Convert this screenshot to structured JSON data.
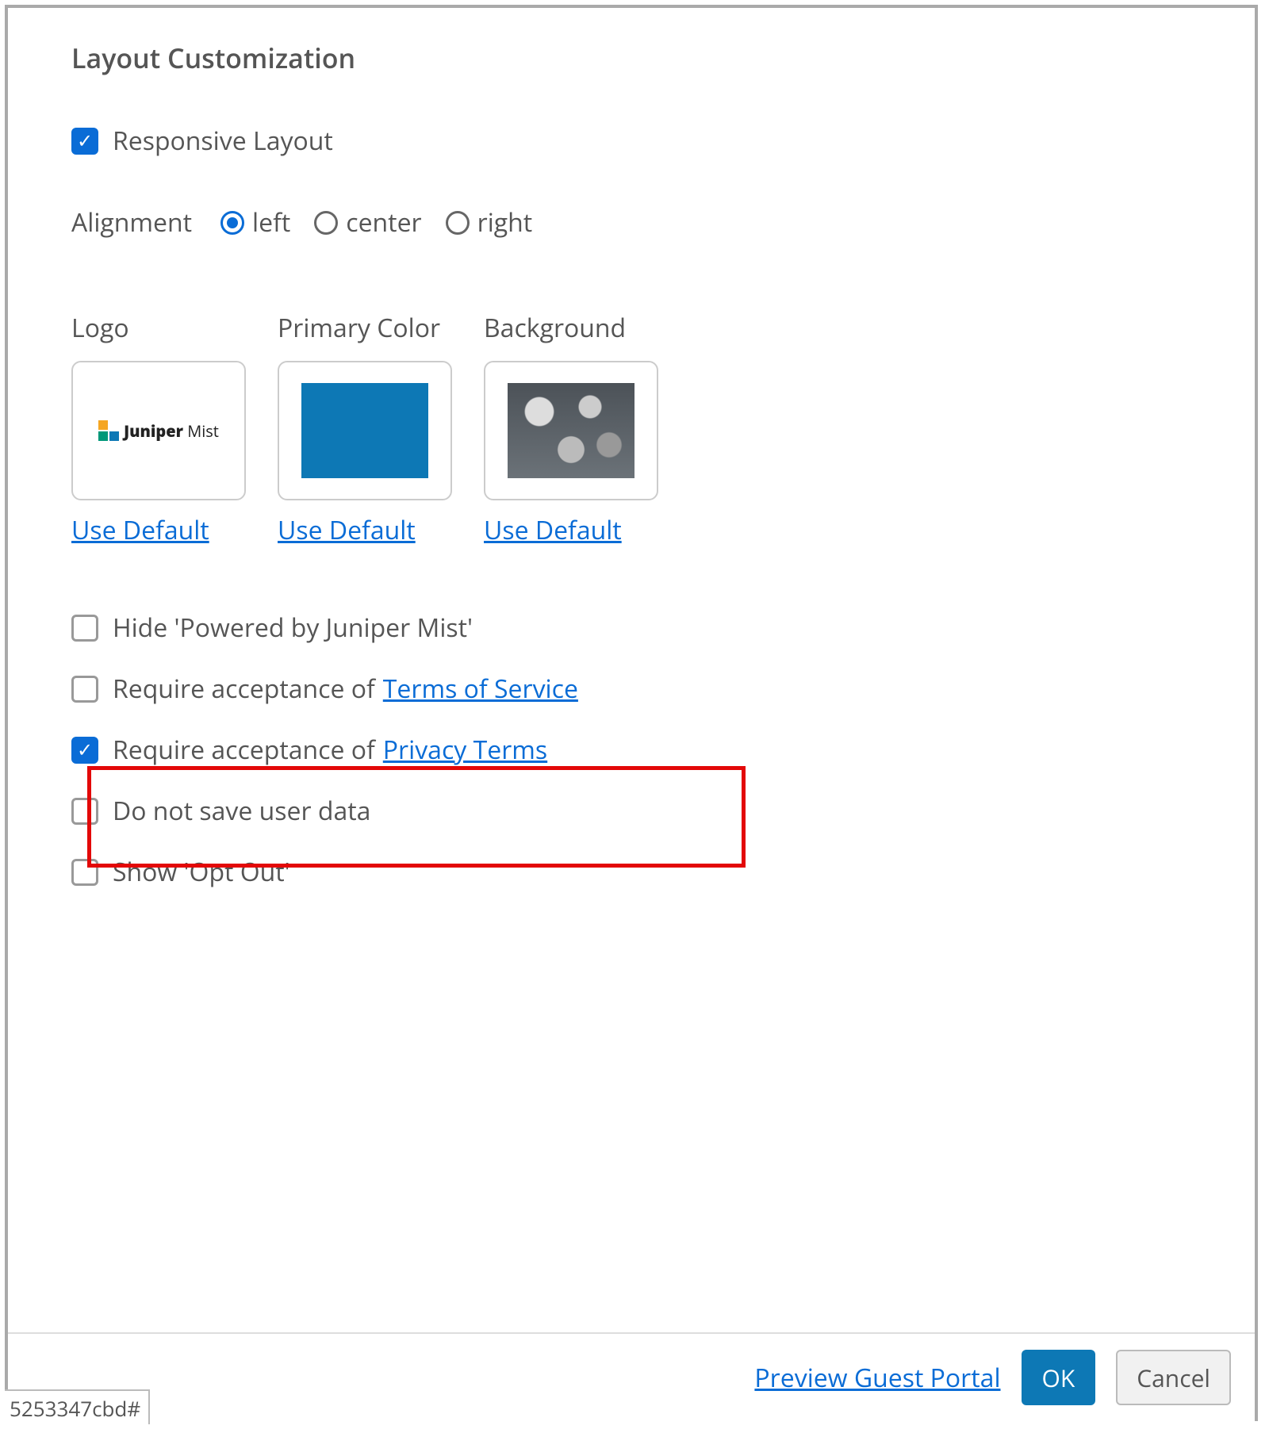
{
  "section_title": "Layout Customization",
  "responsive": {
    "label": "Responsive Layout",
    "checked": true
  },
  "alignment": {
    "label": "Alignment",
    "options": [
      {
        "value": "left",
        "label": "left",
        "selected": true
      },
      {
        "value": "center",
        "label": "center",
        "selected": false
      },
      {
        "value": "right",
        "label": "right",
        "selected": false
      }
    ]
  },
  "previews": {
    "logo": {
      "label": "Logo",
      "thumb_text": "Juniper Mist",
      "action": "Use Default"
    },
    "primary_color": {
      "label": "Primary Color",
      "hex": "#0d78b5",
      "action": "Use Default"
    },
    "background": {
      "label": "Background",
      "action": "Use Default"
    }
  },
  "options": [
    {
      "key": "hide-powered",
      "label": "Hide 'Powered by Juniper Mist'",
      "checked": false,
      "link": null
    },
    {
      "key": "require-tos",
      "label": "Require acceptance of ",
      "checked": false,
      "link": "Terms of Service"
    },
    {
      "key": "require-privacy",
      "label": "Require acceptance of ",
      "checked": true,
      "link": "Privacy Terms",
      "highlighted": true
    },
    {
      "key": "no-save",
      "label": "Do not save user data",
      "checked": false,
      "link": null
    },
    {
      "key": "show-opt-out",
      "label": "Show 'Opt Out'",
      "checked": false,
      "link": null
    }
  ],
  "footer": {
    "preview_link": "Preview Guest Portal",
    "ok": "OK",
    "cancel": "Cancel"
  },
  "hash": "5253347cbd#"
}
